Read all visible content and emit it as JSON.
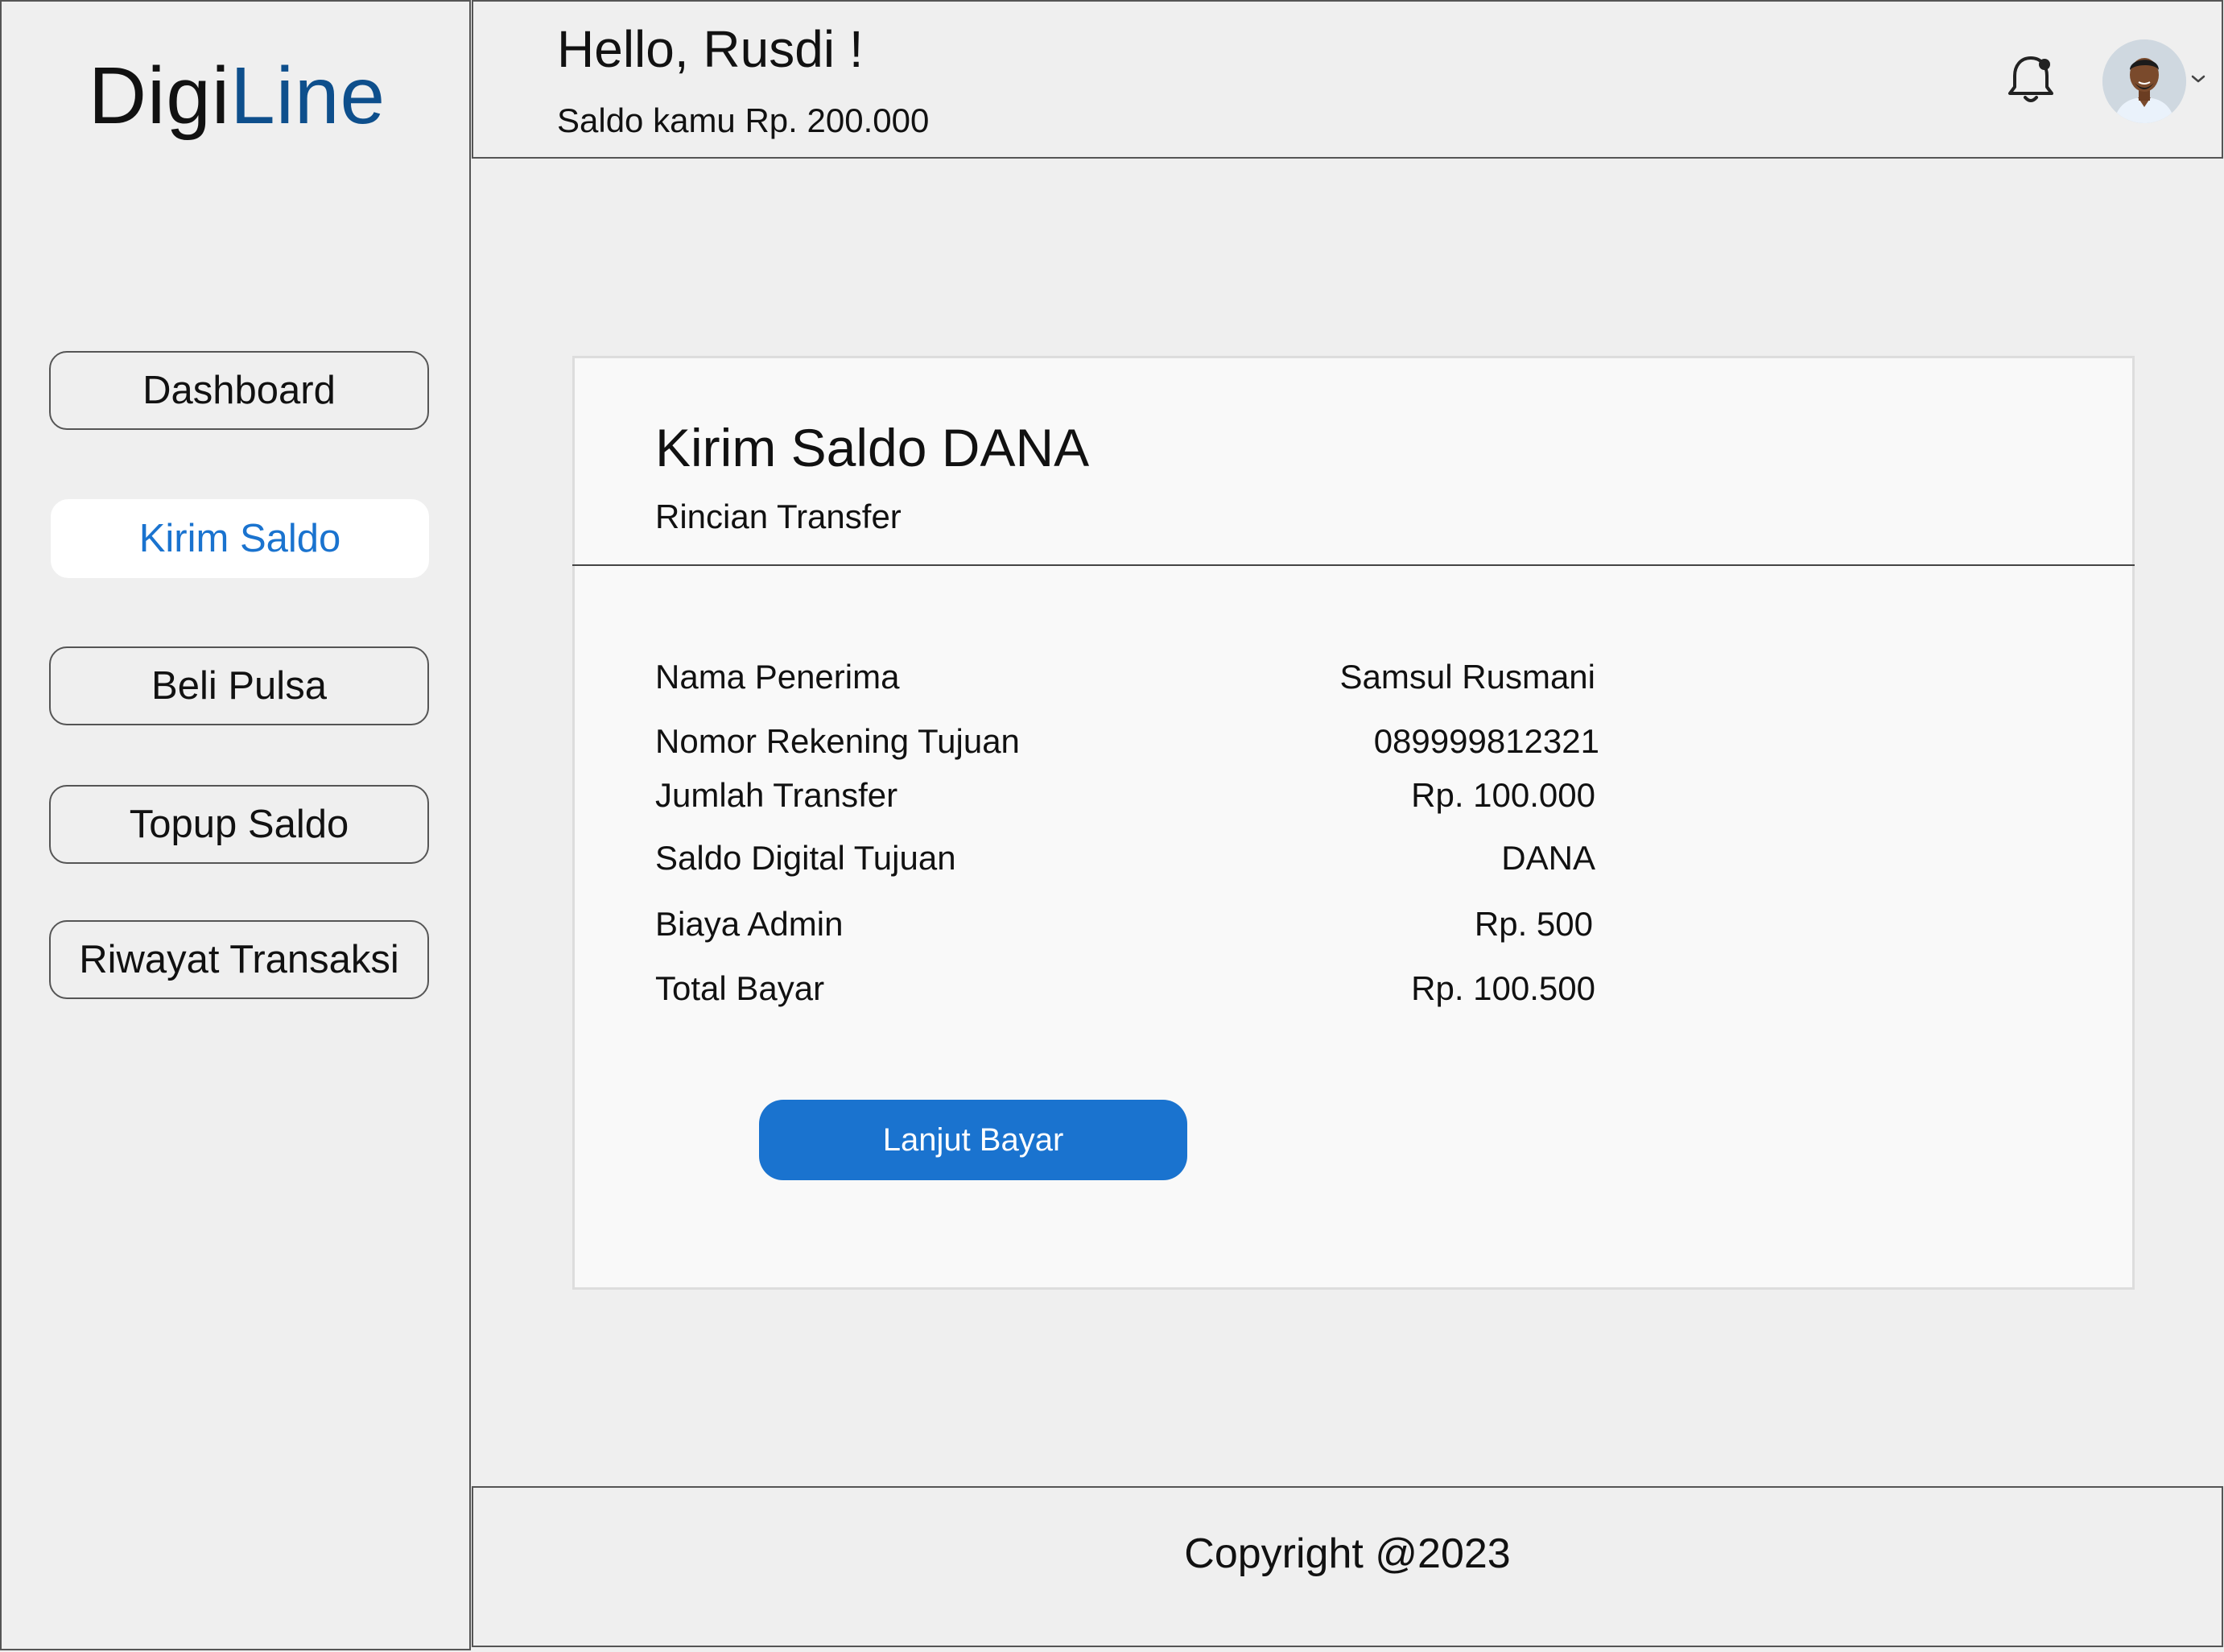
{
  "app": {
    "logo_part1": "Digi",
    "logo_part2": "Line"
  },
  "sidebar": {
    "items": [
      {
        "label": "Dashboard"
      },
      {
        "label": "Kirim Saldo",
        "active": true
      },
      {
        "label": "Beli Pulsa"
      },
      {
        "label": "Topup Saldo"
      },
      {
        "label": "Riwayat Transaksi"
      }
    ]
  },
  "header": {
    "greeting": "Hello, Rusdi !",
    "balance": "Saldo kamu Rp. 200.000",
    "icons": [
      "bell-icon",
      "avatar",
      "chevron-down-icon"
    ]
  },
  "card": {
    "title": "Kirim Saldo DANA",
    "subtitle": "Rincian Transfer",
    "rows": [
      {
        "label": "Nama Penerima",
        "value": "Samsul Rusmani"
      },
      {
        "label": "Nomor Rekening Tujuan",
        "value": "089999812321"
      },
      {
        "label": "Jumlah Transfer",
        "value": "Rp. 100.000"
      },
      {
        "label": "Saldo Digital Tujuan",
        "value": "DANA"
      },
      {
        "label": "Biaya Admin",
        "value": "Rp. 500"
      },
      {
        "label": "Total Bayar",
        "value": "Rp. 100.500"
      }
    ],
    "button_label": "Lanjut Bayar"
  },
  "footer": {
    "copyright": "Copyright @2023"
  },
  "colors": {
    "accent": "#1a73cf",
    "logo_blue": "#0e4f8c",
    "background": "#efefef",
    "card": "#f9f9f9"
  }
}
